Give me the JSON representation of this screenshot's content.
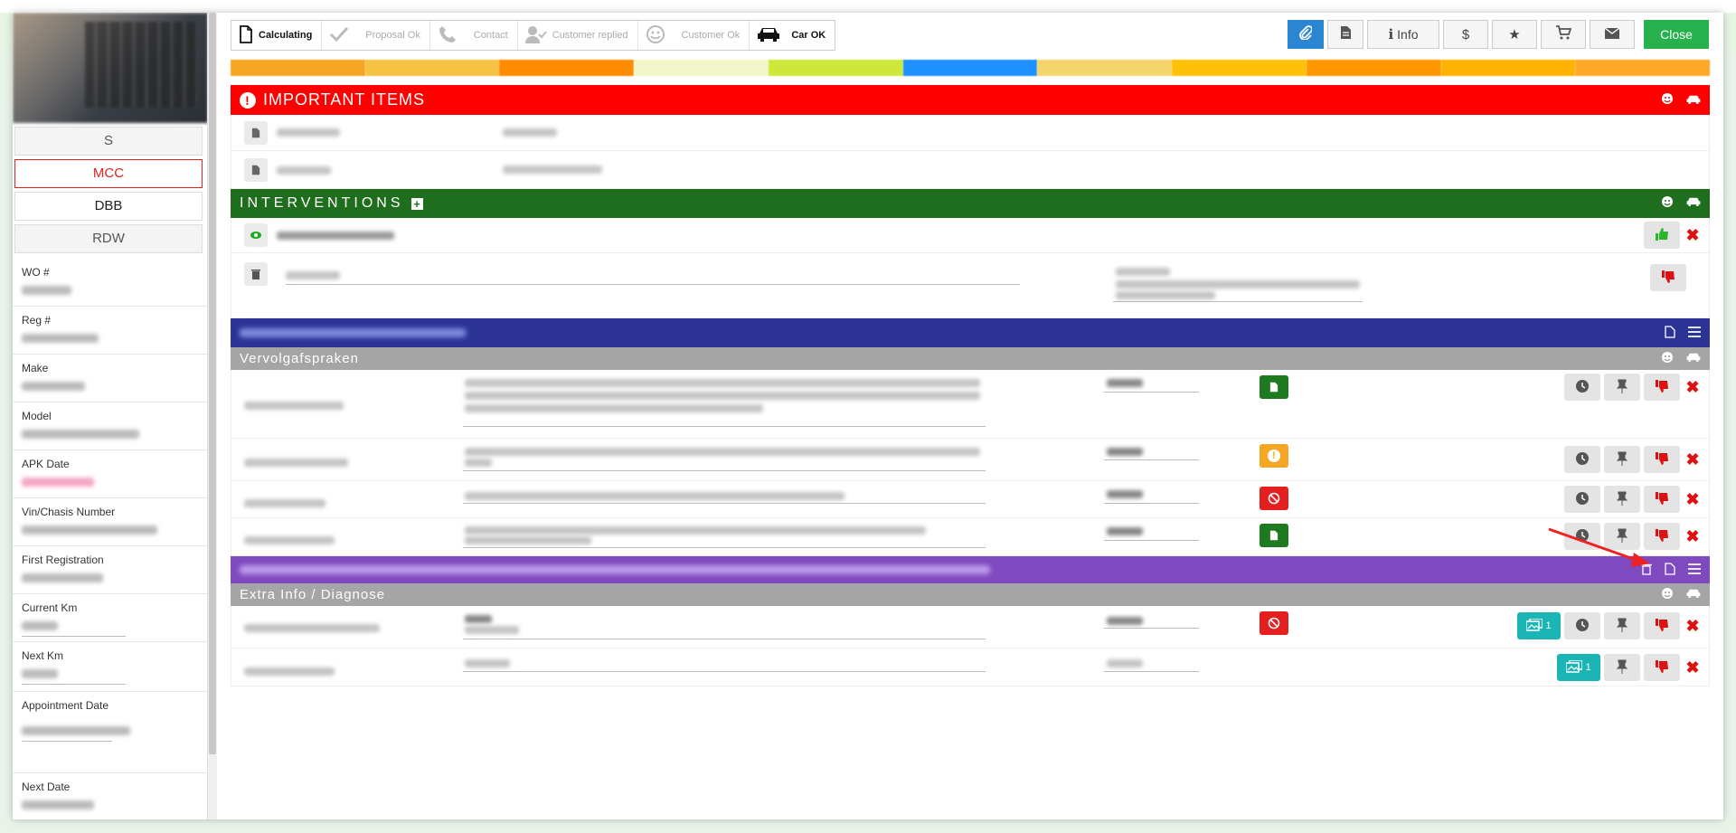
{
  "left": {
    "buttons": [
      "S",
      "MCC",
      "DBB",
      "RDW"
    ],
    "fields": [
      {
        "label": "WO #"
      },
      {
        "label": "Reg #"
      },
      {
        "label": "Make"
      },
      {
        "label": "Model"
      },
      {
        "label": "APK Date"
      },
      {
        "label": "Vin/Chasis Number"
      },
      {
        "label": "First Registration"
      },
      {
        "label": "Current Km"
      },
      {
        "label": "Next Km"
      },
      {
        "label": "Appointment Date"
      },
      {
        "label": "Next Date"
      }
    ]
  },
  "workflow": [
    {
      "label": "Calculating",
      "icon": "document-icon",
      "done": true
    },
    {
      "label": "Proposal Ok",
      "icon": "check-icon",
      "done": false
    },
    {
      "label": "Contact",
      "icon": "phone-icon",
      "done": false
    },
    {
      "label": "Customer replied",
      "icon": "user-check-icon",
      "done": false
    },
    {
      "label": "Customer Ok",
      "icon": "smiley-icon",
      "done": false
    },
    {
      "label": "Car OK",
      "icon": "car-icon",
      "done": true
    }
  ],
  "toolbar": {
    "info_label": "Info",
    "close_label": "Close"
  },
  "sections": {
    "important_title": "IMPORTANT ITEMS",
    "interventions_title": "INTERVENTIONS",
    "followup_subtitle": "Vervolgafspraken",
    "extra_subtitle": "Extra Info / Diagnose"
  },
  "colors": {
    "important": "#ff0000",
    "interventions": "#1e6e1e",
    "navy": "#2b3494",
    "purple": "#7f49bf",
    "subheader": "#a5a5a5",
    "strip": [
      "#f5a623",
      "#f5c242",
      "#ff8c00",
      "#f5f7d0",
      "#d4ea3a",
      "#1e90ff",
      "#f3d56b",
      "#ffc107",
      "#ff9800",
      "#ffb300",
      "#ffa726"
    ]
  },
  "attachments": {
    "extra_row1_count": "1",
    "extra_row2_count": "1"
  }
}
